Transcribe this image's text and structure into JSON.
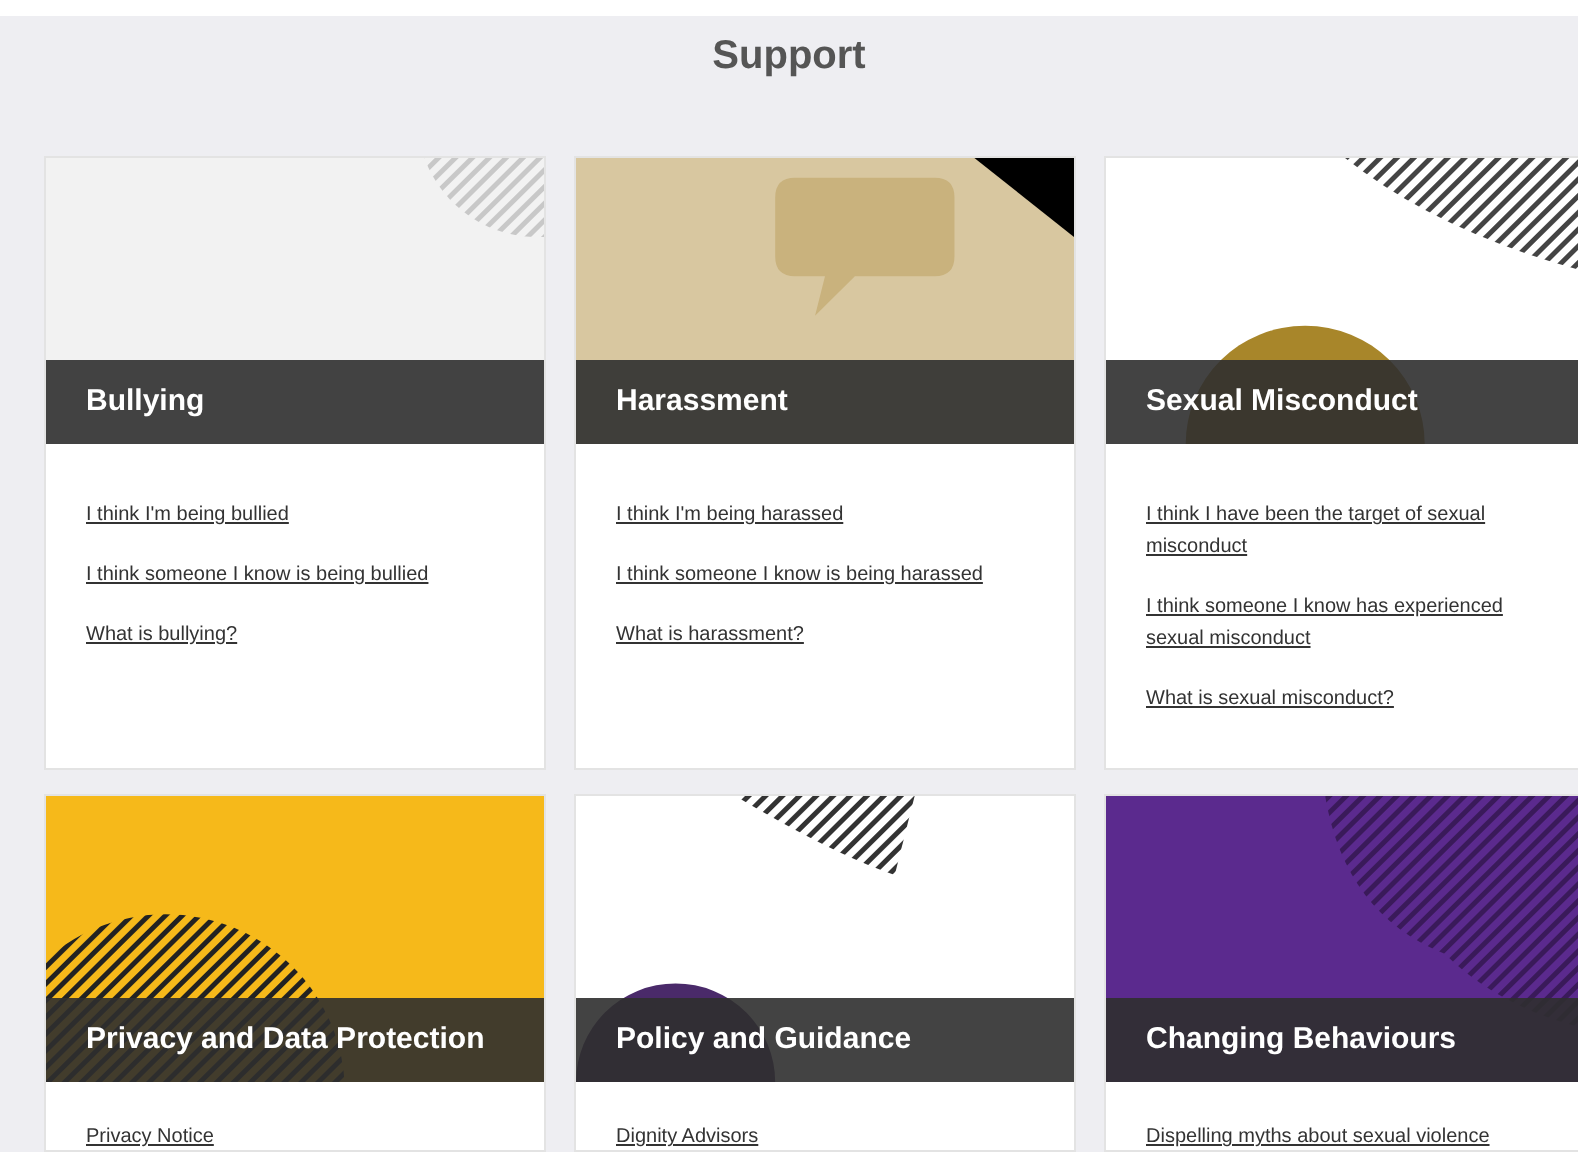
{
  "page_title": "Support",
  "cards": [
    {
      "title": "Bullying",
      "kind": "grey",
      "links": [
        "I think I'm being bullied",
        "I think someone I know is being bullied",
        "What is bullying?"
      ]
    },
    {
      "title": "Harassment",
      "kind": "tan",
      "links": [
        "I think I'm being harassed",
        "I think someone I know is being harassed",
        "What is harassment?"
      ]
    },
    {
      "title": "Sexual Misconduct",
      "kind": "gold",
      "links": [
        "I think I have been the target of sexual misconduct",
        "I think someone I know has experienced sexual misconduct",
        "What is sexual misconduct?"
      ]
    },
    {
      "title": "Privacy and Data Protection",
      "kind": "yellow",
      "links": [
        "Privacy Notice"
      ]
    },
    {
      "title": "Policy and Guidance",
      "kind": "violet",
      "links": [
        "Dignity Advisors"
      ]
    },
    {
      "title": "Changing Behaviours",
      "kind": "purple",
      "links": [
        "Dispelling myths about sexual violence"
      ]
    }
  ]
}
